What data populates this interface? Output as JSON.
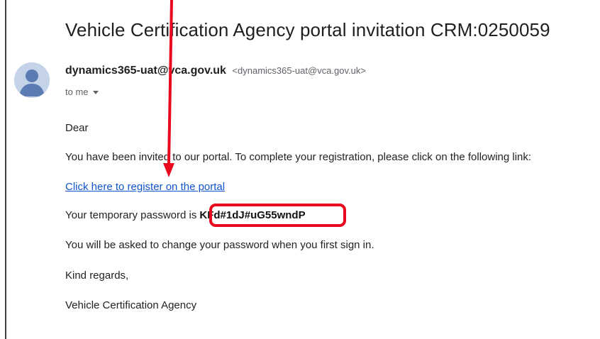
{
  "email": {
    "subject": "Vehicle Certification Agency portal invitation CRM:0250059",
    "sender_name": "dynamics365-uat@vca.gov.uk",
    "sender_email": "<dynamics365-uat@vca.gov.uk>",
    "recipient": "to me",
    "body": {
      "greeting": "Dear",
      "intro": "You have been invited to our portal. To complete your registration, please click on the following link:",
      "link_text": "Click here to register on the portal",
      "password_label": "Your temporary password is",
      "password_value": "KFd#1dJ#uG55wndP",
      "change_notice": "You will be asked to change your password when you first sign in.",
      "closing": "Kind regards,",
      "signature": "Vehicle Certification Agency"
    }
  },
  "annotation": {
    "arrow_color": "#e8091f",
    "box_color": "#e8091f"
  },
  "colors": {
    "link": "#1155cc",
    "avatar_bg": "#c5d3e8",
    "avatar_fg": "#5b7bb3"
  }
}
